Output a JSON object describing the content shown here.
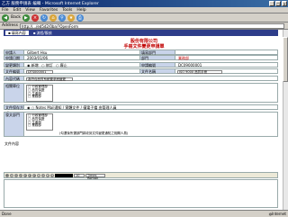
{
  "window": {
    "title": "乙方 服務申請表 編輯 - Microsoft Internet Explorer"
  },
  "menu": [
    "File",
    "Edit",
    "View",
    "Favorites",
    "Tools",
    "Help"
  ],
  "toolbar": {
    "back_label": "Back"
  },
  "address": {
    "label": "Address",
    "url": "http://.../ed5d2/0ba/?OpenForm"
  },
  "tabs": [
    "填寫內容",
    "流程/簽核"
  ],
  "header": {
    "company": "股份有限公司",
    "form_title": "手冊文件變更申請單"
  },
  "form": {
    "applicant_label": "申請人",
    "applicant": "Gilbert Hsu",
    "dept_label": "填寫部門",
    "dept": "",
    "date_label": "申請日期",
    "date": "2003/01/06",
    "division_label": "部門",
    "division": "業務部",
    "type_label": "變更類別",
    "type_options": [
      "新增",
      "修訂",
      "廢止"
    ],
    "form_no_label": "申請編號",
    "form_no": "DC09000001",
    "doc_no_label": "文件編號",
    "doc_no": "DTS000001",
    "doc_name_label": "文件名稱",
    "doc_name": "ISO 9000 品質手冊",
    "reason_label": "內容代碼",
    "reason": "為符合品質系統要求而變更",
    "cat_label": "相關單位",
    "cat_items": [
      "□ 行政管理部",
      "□ 品質保證",
      "□ 生產部",
      "□ 業務部"
    ],
    "notes_label": "文件保存方式",
    "notes_text": "Notes Mail通知 / 實體文件 / 僅電子檔 由管理人員",
    "notify_label": "發文部門",
    "notify_items": [
      "□ 行政管理部",
      "□ 品質保證",
      "□ 生產部",
      "□ 業務部"
    ],
    "notify_note": "(勾選後所選部門將收到文件變更通知之相關人員)",
    "content_label": "文件內容"
  },
  "editor": {
    "font_size": "10",
    "font_name": "Times Roman"
  },
  "status": {
    "left": "Done",
    "right": "Internet"
  }
}
